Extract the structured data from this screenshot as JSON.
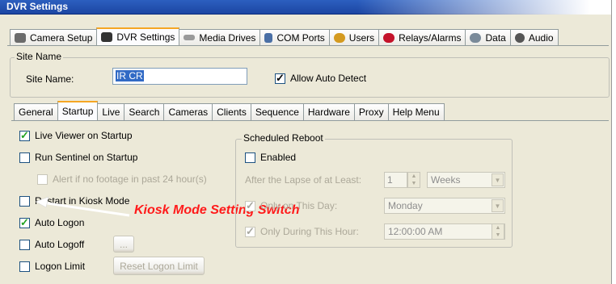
{
  "window": {
    "title": "DVR Settings"
  },
  "main_tabs": [
    {
      "label": "Camera Setup",
      "icon": "camera-icon",
      "color": "#6b6b6b"
    },
    {
      "label": "DVR Settings",
      "icon": "dvr-icon",
      "color": "#333333",
      "active": true
    },
    {
      "label": "Media Drives",
      "icon": "drive-icon",
      "color": "#8a8a8a"
    },
    {
      "label": "COM Ports",
      "icon": "port-icon",
      "color": "#4a6fa5"
    },
    {
      "label": "Users",
      "icon": "users-icon",
      "color": "#d49a1f"
    },
    {
      "label": "Relays/Alarms",
      "icon": "alarm-icon",
      "color": "#c4122a"
    },
    {
      "label": "Data",
      "icon": "data-icon",
      "color": "#7a8a99"
    },
    {
      "label": "Audio",
      "icon": "audio-icon",
      "color": "#555555"
    }
  ],
  "site": {
    "group_label": "Site Name",
    "field_label": "Site Name:",
    "field_value": "IR CR",
    "auto_detect_label": "Allow Auto Detect",
    "auto_detect_checked": true
  },
  "inner_tabs": [
    "General",
    "Startup",
    "Live",
    "Search",
    "Cameras",
    "Clients",
    "Sequence",
    "Hardware",
    "Proxy",
    "Help Menu"
  ],
  "startup": {
    "live_viewer": "Live Viewer on Startup",
    "run_sentinel": "Run Sentinel on Startup",
    "alert_footage": "Alert if no footage in past 24 hour(s)",
    "restart_kiosk": "Restart in Kiosk Mode",
    "auto_logon": "Auto Logon",
    "auto_logoff": "Auto Logoff",
    "ellipsis": "...",
    "logon_limit": "Logon Limit",
    "reset_logon_limit": "Reset Logon Limit"
  },
  "reboot": {
    "group_label": "Scheduled Reboot",
    "enabled_label": "Enabled",
    "lapse_label": "After the Lapse of at Least:",
    "lapse_value": "1",
    "lapse_unit": "Weeks",
    "day_label": "Only on This Day:",
    "day_value": "Monday",
    "hour_label": "Only During This Hour:",
    "hour_value": "12:00:00 AM"
  },
  "annotation": {
    "text": "Kiosk Mode Setting Switch",
    "color": "#ff1a1a"
  }
}
